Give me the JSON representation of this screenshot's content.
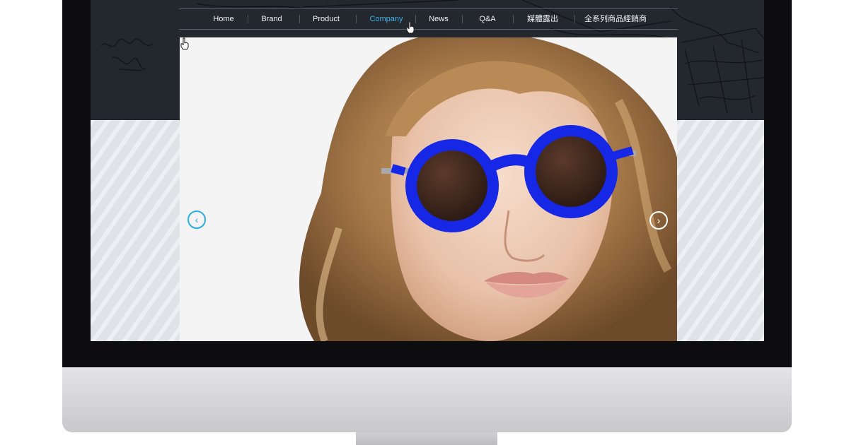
{
  "site": {
    "nav": {
      "items": [
        {
          "label": "Home"
        },
        {
          "label": "Brand"
        },
        {
          "label": "Product"
        },
        {
          "label": "Company",
          "active": true
        },
        {
          "label": "News"
        },
        {
          "label": "Q&A"
        },
        {
          "label": "媒體露出"
        },
        {
          "label": "全系列商品經銷商"
        }
      ]
    },
    "slider": {
      "prev_icon": "chevron-left-icon",
      "next_icon": "chevron-right-icon",
      "prev_glyph": "‹",
      "next_glyph": "›"
    }
  },
  "colors": {
    "header_bg": "#23272e",
    "nav_active": "#3fb4e5",
    "nav_text": "#f1f3f5",
    "sunglasses_frame": "#1627e6",
    "prev_arrow": "#27aee4",
    "bezel": "#0d0d0f"
  }
}
